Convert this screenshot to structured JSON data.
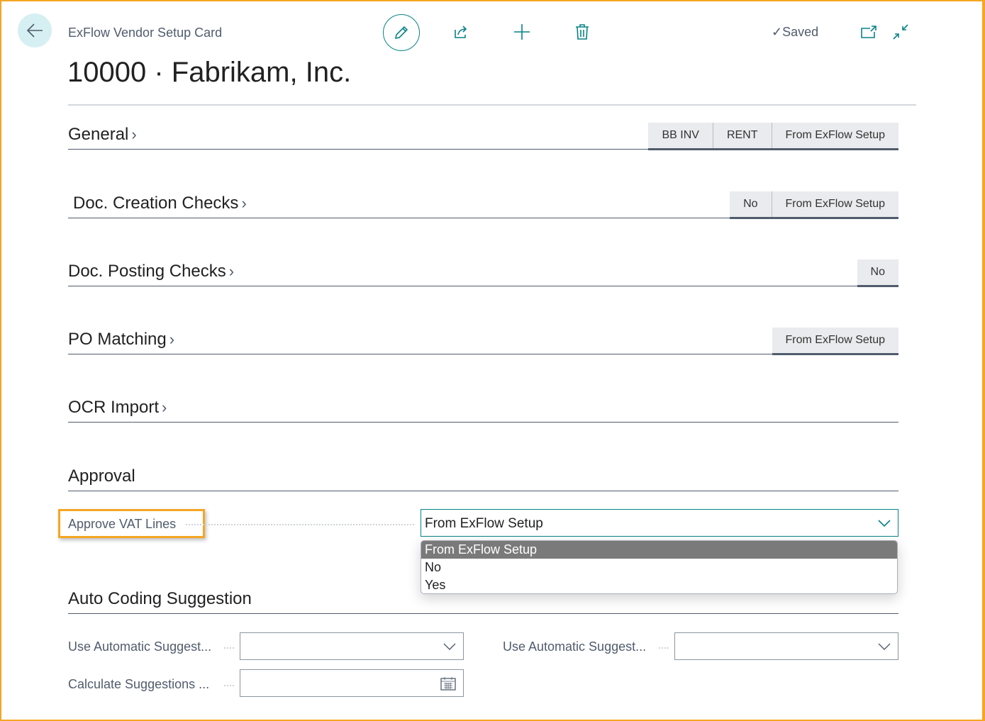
{
  "header": {
    "breadcrumb": "ExFlow Vendor Setup Card",
    "title": "10000 · Fabrikam, Inc.",
    "status": "Saved"
  },
  "sections": [
    {
      "title": "General",
      "tags": [
        "BB INV",
        "RENT",
        "From ExFlow Setup"
      ]
    },
    {
      "title": "Doc. Creation Checks",
      "tags": [
        "No",
        "From ExFlow Setup"
      ]
    },
    {
      "title": "Doc. Posting Checks",
      "tags": [
        "No"
      ]
    },
    {
      "title": "PO Matching",
      "tags": [
        "From ExFlow Setup"
      ]
    },
    {
      "title": "OCR Import",
      "tags": []
    },
    {
      "title": "Approval",
      "tags": []
    },
    {
      "title": "Auto Coding Suggestion",
      "tags": []
    }
  ],
  "approval": {
    "field_label": "Approve VAT Lines",
    "value": "From ExFlow Setup",
    "options": [
      "From ExFlow Setup",
      "No",
      "Yes"
    ]
  },
  "auto_coding": {
    "field1_label": "Use Automatic Suggest...",
    "field1_value": "",
    "field2_label": "Use Automatic Suggest...",
    "field2_value": "",
    "field3_label": "Calculate Suggestions ...",
    "field3_value": ""
  },
  "colors": {
    "accent": "#078387",
    "highlight": "#f5a623"
  }
}
